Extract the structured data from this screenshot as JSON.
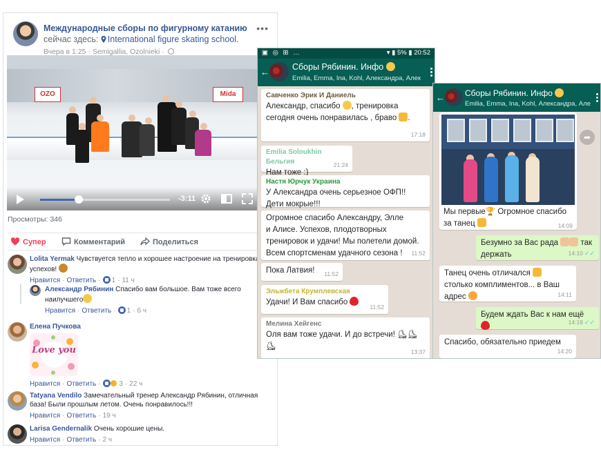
{
  "facebook": {
    "page_name": "Международные сборы по фигурному катанию",
    "header_rest": "сейчас здесь:",
    "place": "International figure skating school",
    "meta": "Вчера в 1:25 · Semigallia, Ozolnieki ·",
    "video": {
      "time_left": "-3:11",
      "progress": 0.3,
      "banners": [
        "OZO",
        "Mida"
      ]
    },
    "views": "Просмотры: 346",
    "actions": {
      "super": "Супер",
      "comment": "Комментарий",
      "share": "Поделиться"
    },
    "comments": [
      {
        "name": "Lolita Yermak",
        "text": "Чувствуется тепло и хорошее настроение на тренировках, успехов!",
        "like": "Нравится",
        "reply": "Ответить",
        "reactions": "1",
        "time": "11 ч"
      },
      {
        "name": "Александр Рябинин",
        "text": "Спасибо вам большое. Вам тоже всего наилучшего",
        "like": "Нравится",
        "reply": "Ответить",
        "reactions": "1",
        "time": "6 ч"
      },
      {
        "name": "Елена Пучкова",
        "sticker_text": "Love you",
        "like": "Нравится",
        "reply": "Ответить",
        "reactions": "3",
        "time": "22 ч"
      },
      {
        "name": "Tatyana Vendilo",
        "text": "Замечательный тренер Александр Рябинин, отличная база! Были прошлым летом. Очень понравилось!!!",
        "like": "Нравится",
        "reply": "Ответить",
        "time": "19 ч"
      },
      {
        "name": "Larisa Gendernalik",
        "text": "Очень хорошие цены.",
        "like": "Нравится",
        "reply": "Ответить",
        "time": "2 ч"
      }
    ],
    "colors": {
      "link": "#385898",
      "super": "#f33e58"
    }
  },
  "phone1": {
    "status_time": "20:52",
    "status_battery": "5%",
    "group_title": "Сборы Рябинин. Инфо",
    "members": "Emilia, Emma, Ina, Kohl, Александра, Александр...",
    "messages": [
      {
        "sender": "Савченко Эрик И Даниель",
        "sender_color": "#6d5b3f",
        "lines": [
          "Александр, спасибо",
          ", тренировка",
          "сегодня очень понравилась , браво"
        ],
        "time": "17:18"
      },
      {
        "sender": "Emilia Soloukhin Бельгия",
        "sender_color": "#7fc9a4",
        "lines": [
          "Нам тоже :)"
        ],
        "time": "21:24"
      },
      {
        "sender": "Настя Юрчук Украина",
        "sender_color": "#2a9a3c",
        "lines": [
          "У Александра очень серьезное ОФП!!",
          "Дети мокрые!!!"
        ],
        "time": ""
      },
      {
        "sender": "",
        "lines": [
          "Огромное спасибо Александру, Элле",
          "и Алисе. Успехов, плодотворных",
          "тренировок и удачи! Мы полетели домой.",
          "Всем спортсменам удачного сезона !"
        ],
        "time": "11:52"
      },
      {
        "sender": "",
        "lines": [
          "Пока Латвия!"
        ],
        "time": "11:52"
      },
      {
        "sender": "Эльжбета Крумплевская",
        "sender_color": "#c2b630",
        "lines": [
          "Удачи! И Вам спасибо"
        ],
        "time": "11:52"
      },
      {
        "sender": "Мелина Хейгенс",
        "sender_color": "#7a7a7a",
        "lines": [
          "Оля вам тоже удачи. И до встречи!"
        ],
        "time": "13:37"
      }
    ]
  },
  "phone2": {
    "group_title": "Сборы Рябинин. Инфо",
    "members": "Emilia, Emma, Ina, Kohl, Александра, Александр...",
    "messages": [
      {
        "dir": "in",
        "lines": [
          "Мы первые",
          " Огромное спасибо",
          "за танец"
        ],
        "time": "14:09"
      },
      {
        "dir": "out",
        "lines": [
          "Безумно за Вас рада",
          " так",
          "держать"
        ],
        "time": "14:10"
      },
      {
        "dir": "in",
        "lines": [
          "Танец очень отличался",
          "столько комплиментов... в Ваш",
          "адрес"
        ],
        "time": "14:11"
      },
      {
        "dir": "out",
        "lines": [
          "Будем ждать Вас к нам ещё"
        ],
        "time": "14:19"
      },
      {
        "dir": "in",
        "lines": [
          "Спасибо, обязательно приедем"
        ],
        "time": "14:20"
      }
    ]
  }
}
